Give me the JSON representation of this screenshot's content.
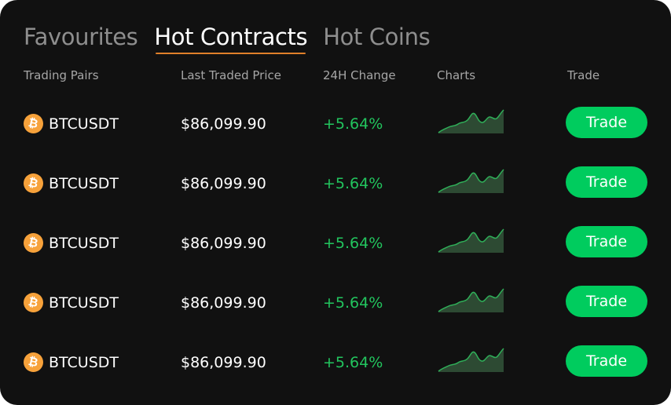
{
  "tabs": [
    {
      "label": "Favourites",
      "active": false
    },
    {
      "label": "Hot Contracts",
      "active": true
    },
    {
      "label": "Hot Coins",
      "active": false
    }
  ],
  "columns": {
    "pair": "Trading Pairs",
    "price": "Last Traded Price",
    "change": "24H Change",
    "charts": "Charts",
    "trade": "Trade"
  },
  "rows": [
    {
      "icon": "bitcoin-icon",
      "symbol": "₿",
      "pair": "BTCUSDT",
      "price": "$86,099.90",
      "change": "+5.64%",
      "button": "Trade"
    },
    {
      "icon": "bitcoin-icon",
      "symbol": "₿",
      "pair": "BTCUSDT",
      "price": "$86,099.90",
      "change": "+5.64%",
      "button": "Trade"
    },
    {
      "icon": "bitcoin-icon",
      "symbol": "₿",
      "pair": "BTCUSDT",
      "price": "$86,099.90",
      "change": "+5.64%",
      "button": "Trade"
    },
    {
      "icon": "bitcoin-icon",
      "symbol": "₿",
      "pair": "BTCUSDT",
      "price": "$86,099.90",
      "change": "+5.64%",
      "button": "Trade"
    },
    {
      "icon": "bitcoin-icon",
      "symbol": "₿",
      "pair": "BTCUSDT",
      "price": "$86,099.90",
      "change": "+5.64%",
      "button": "Trade"
    }
  ],
  "colors": {
    "background": "#111111",
    "tab_active": "#ffffff",
    "tab_inactive": "#8e8e8e",
    "tab_underline": "#e0802a",
    "positive": "#22c55e",
    "button": "#00cc5e",
    "coin": "#f7a23b",
    "spark_line": "#2fae58",
    "spark_fill": "#2d4a33"
  }
}
